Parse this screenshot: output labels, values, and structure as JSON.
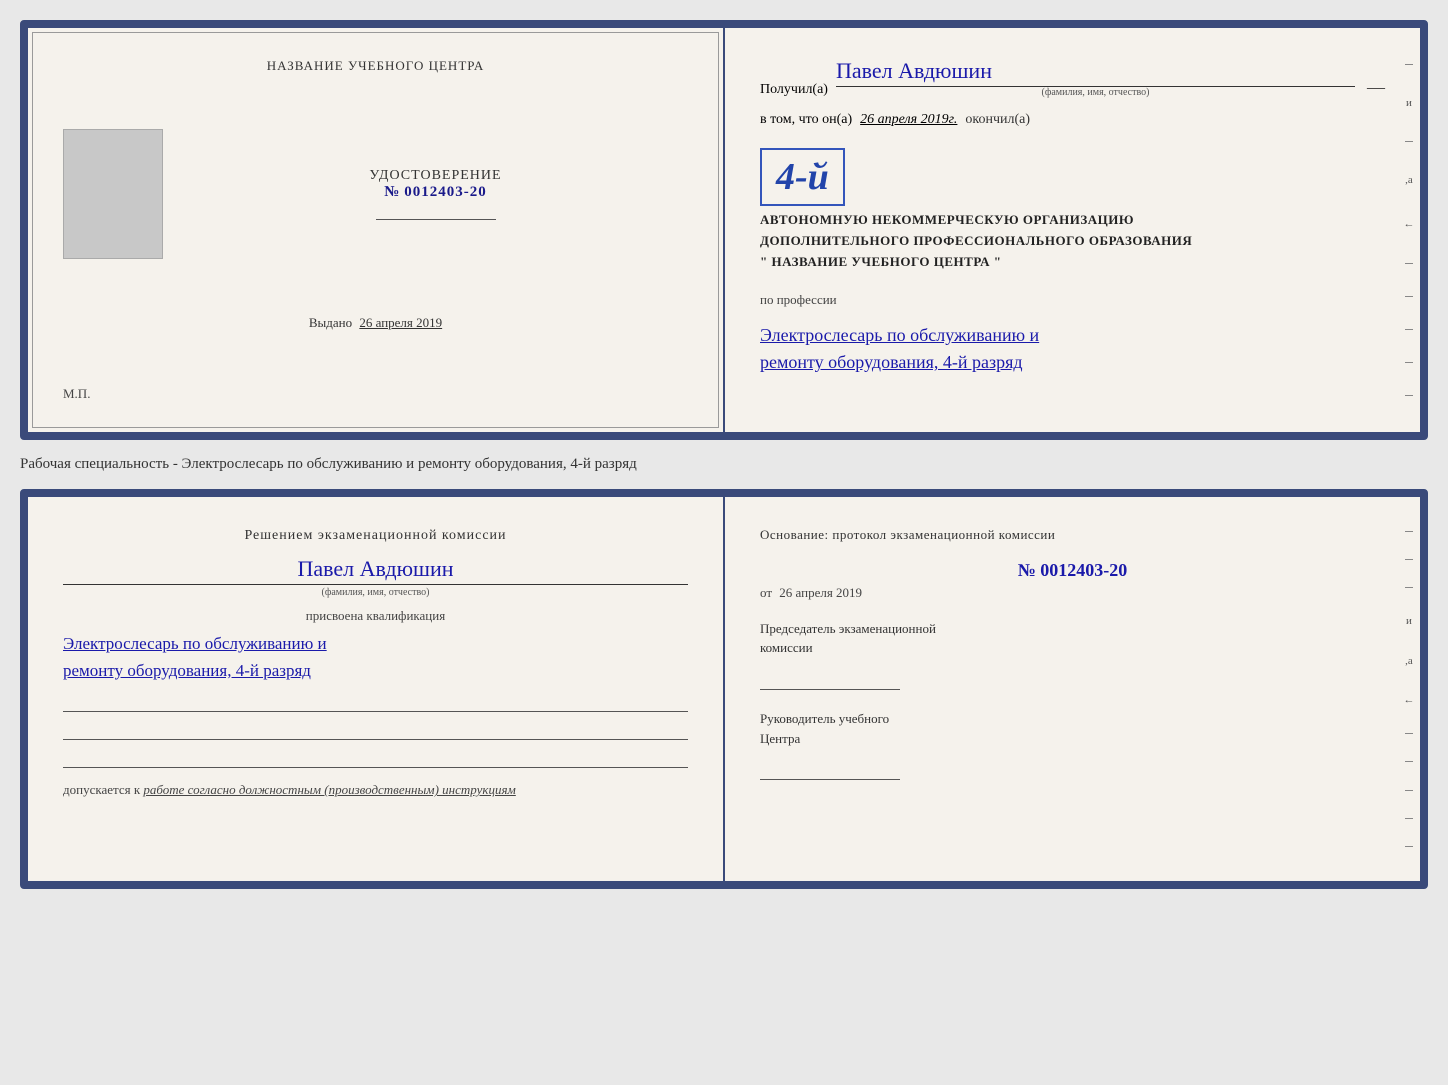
{
  "page": {
    "background": "#e8e8e8"
  },
  "top_document": {
    "left": {
      "title": "НАЗВАНИЕ УЧЕБНОГО ЦЕНТРА",
      "photo_alt": "photo placeholder",
      "udost_label": "УДОСТОВЕРЕНИЕ",
      "number_prefix": "№",
      "number": "0012403-20",
      "vydano_label": "Выдано",
      "vydano_date": "26 апреля 2019",
      "mp_label": "М.П."
    },
    "right": {
      "poluchil_label": "Получил(a)",
      "name": "Павел Авдюшин",
      "fio_hint": "(фамилия, имя, отчество)",
      "dash": "—",
      "vtom_label": "в том, что он(а)",
      "date_text": "26 апреля 2019г.",
      "okonchil_label": "окончил(а)",
      "stamp_grade": "4-й",
      "stamp_line1": "АВТОНОМНУЮ НЕКОММЕРЧЕСКУЮ ОРГАНИЗАЦИЮ",
      "stamp_line2": "ДОПОЛНИТЕЛЬНОГО ПРОФЕССИОНАЛЬНОГО ОБРАЗОВАНИЯ",
      "stamp_line3": "\" НАЗВАНИЕ УЧЕБНОГО ЦЕНТРА \"",
      "po_professii": "по профессии",
      "professiya_line1": "Электрослесарь по обслуживанию и",
      "professiya_line2": "ремонту оборудования, 4-й разряд"
    }
  },
  "middle_text": {
    "text": "Рабочая специальность - Электрослесарь по обслуживанию и ремонту оборудования, 4-й разряд"
  },
  "bottom_document": {
    "left": {
      "reshen_title": "Решением экзаменационной комиссии",
      "name": "Павел Авдюшин",
      "fio_hint": "(фамилия, имя, отчество)",
      "prisvoena_label": "присвоена квалификация",
      "qual_line1": "Электрослесарь по обслуживанию и",
      "qual_line2": "ремонту оборудования, 4-й разряд",
      "dopusk_label": "допускается к",
      "dopusk_text": "работе согласно должностным (производственным) инструкциям"
    },
    "right": {
      "osnov_label": "Основание: протокол экзаменационной комиссии",
      "number_prefix": "№",
      "number": "0012403-20",
      "ot_prefix": "от",
      "ot_date": "26 апреля 2019",
      "predsedatel_line1": "Председатель экзаменационной",
      "predsedatel_line2": "комиссии",
      "rukov_line1": "Руководитель учебного",
      "rukov_line2": "Центра"
    }
  },
  "right_ticks": [
    "и",
    "",
    "а",
    "←",
    "",
    "",
    "",
    "",
    ""
  ]
}
